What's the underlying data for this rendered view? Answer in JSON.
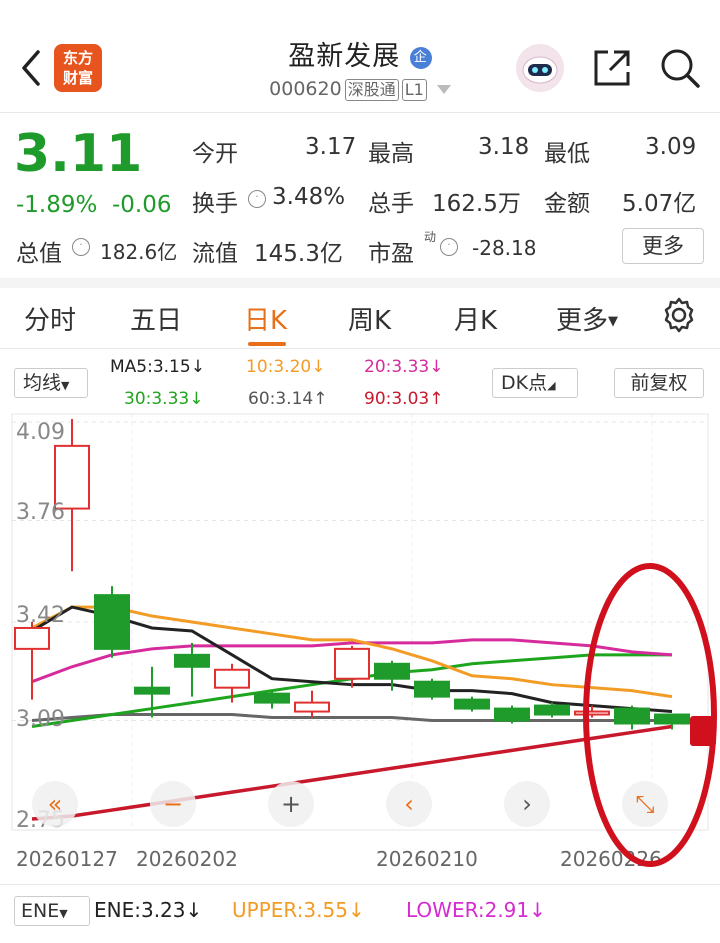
{
  "header": {
    "name": "盈新发展",
    "enterprise_badge": "企",
    "code": "000620",
    "tag1": "深股通",
    "tag2": "L1",
    "logo": {
      "line1": "东方",
      "line2": "财富",
      "color": "#e8541e"
    }
  },
  "quote": {
    "price": "3.11",
    "pct": "-1.89%",
    "change": "-0.06",
    "open_label": "今开",
    "open": "3.17",
    "high_label": "最高",
    "high": "3.18",
    "low_label": "最低",
    "low": "3.09",
    "turnover_label": "换手",
    "turnover": "3.48%",
    "volume_label": "总手",
    "volume": "162.5万",
    "amount_label": "金额",
    "amount": "5.07亿",
    "mcap_label": "总值",
    "mcap": "182.6亿",
    "float_label": "流值",
    "float": "145.3亿",
    "pe_label": "市盈",
    "pe_sup": "动",
    "pe": "-28.18",
    "more_btn": "更多"
  },
  "tabs": [
    "分时",
    "五日",
    "日K",
    "周K",
    "月K",
    "更多"
  ],
  "active_tab": "日K",
  "ma_bar": {
    "selector": "均线",
    "ma5": "MA5:3.15↓",
    "ma10": "10:3.20↓",
    "ma20": "20:3.33↓",
    "ma30": "30:3.33↓",
    "ma60": "60:3.14↑",
    "ma90": "90:3.03↑",
    "dk": "DK点",
    "fq": "前复权"
  },
  "chart_data": {
    "type": "candlestick",
    "y_ticks": [
      "4.09",
      "3.76",
      "3.42",
      "3.09",
      "2.75"
    ],
    "ylim": [
      2.75,
      4.09
    ],
    "dates": [
      "20260127",
      "20260202",
      "20260210",
      "20260226"
    ],
    "candles": [
      {
        "o": 3.33,
        "c": 3.4,
        "h": 3.42,
        "l": 3.16
      },
      {
        "o": 3.8,
        "c": 4.01,
        "h": 4.1,
        "l": 3.59
      },
      {
        "o": 3.51,
        "c": 3.33,
        "h": 3.54,
        "l": 3.3
      },
      {
        "o": 3.2,
        "c": 3.18,
        "h": 3.27,
        "l": 3.1
      },
      {
        "o": 3.31,
        "c": 3.27,
        "h": 3.35,
        "l": 3.17
      },
      {
        "o": 3.2,
        "c": 3.26,
        "h": 3.28,
        "l": 3.15
      },
      {
        "o": 3.18,
        "c": 3.15,
        "h": 3.19,
        "l": 3.13
      },
      {
        "o": 3.12,
        "c": 3.15,
        "h": 3.19,
        "l": 3.1
      },
      {
        "o": 3.23,
        "c": 3.33,
        "h": 3.34,
        "l": 3.2
      },
      {
        "o": 3.28,
        "c": 3.23,
        "h": 3.29,
        "l": 3.19
      },
      {
        "o": 3.22,
        "c": 3.17,
        "h": 3.23,
        "l": 3.16
      },
      {
        "o": 3.16,
        "c": 3.13,
        "h": 3.17,
        "l": 3.12
      },
      {
        "o": 3.13,
        "c": 3.09,
        "h": 3.14,
        "l": 3.08
      },
      {
        "o": 3.14,
        "c": 3.11,
        "h": 3.15,
        "l": 3.1
      },
      {
        "o": 3.11,
        "c": 3.12,
        "h": 3.14,
        "l": 3.1
      },
      {
        "o": 3.13,
        "c": 3.08,
        "h": 3.14,
        "l": 3.06
      },
      {
        "o": 3.11,
        "c": 3.08,
        "h": 3.11,
        "l": 3.06
      }
    ],
    "ma5": [
      3.39,
      3.47,
      3.44,
      3.4,
      3.39,
      3.31,
      3.23,
      3.22,
      3.21,
      3.21,
      3.19,
      3.19,
      3.18,
      3.15,
      3.14,
      3.13,
      3.12
    ],
    "ma10": [
      3.4,
      3.47,
      3.47,
      3.44,
      3.42,
      3.4,
      3.38,
      3.36,
      3.36,
      3.33,
      3.29,
      3.24,
      3.23,
      3.21,
      3.2,
      3.19,
      3.17
    ],
    "ma20": [
      3.22,
      3.27,
      3.31,
      3.33,
      3.34,
      3.34,
      3.34,
      3.34,
      3.35,
      3.35,
      3.35,
      3.36,
      3.36,
      3.35,
      3.34,
      3.32,
      3.31
    ],
    "ma30": [
      3.07,
      3.09,
      3.11,
      3.13,
      3.15,
      3.17,
      3.19,
      3.21,
      3.23,
      3.25,
      3.26,
      3.28,
      3.29,
      3.3,
      3.31,
      3.31,
      3.31
    ],
    "ma60": [
      3.09,
      3.1,
      3.11,
      3.11,
      3.11,
      3.11,
      3.1,
      3.1,
      3.1,
      3.1,
      3.09,
      3.09,
      3.09,
      3.09,
      3.09,
      3.09,
      3.09
    ],
    "ma90": [
      2.76,
      2.77,
      2.79,
      2.81,
      2.83,
      2.85,
      2.87,
      2.89,
      2.91,
      2.93,
      2.95,
      2.97,
      2.99,
      3.01,
      3.03,
      3.05,
      3.07
    ],
    "colors": {
      "up": "#e03030",
      "down": "#1e9b2a",
      "ma5": "#222222",
      "ma10": "#f39c25",
      "ma20": "#d62b9c",
      "ma30": "#1ea51e",
      "ma60": "#666666",
      "ma90": "#c8182c"
    }
  },
  "controls": [
    "«",
    "−",
    "+",
    "‹",
    "›",
    "⤡"
  ],
  "ene": {
    "selector": "ENE",
    "ene": "ENE:3.23↓",
    "upper": "UPPER:3.55↓",
    "lower": "LOWER:2.91↓"
  },
  "icons": [
    "back-icon",
    "share-icon",
    "search-icon",
    "settings-icon",
    "robot-icon"
  ]
}
